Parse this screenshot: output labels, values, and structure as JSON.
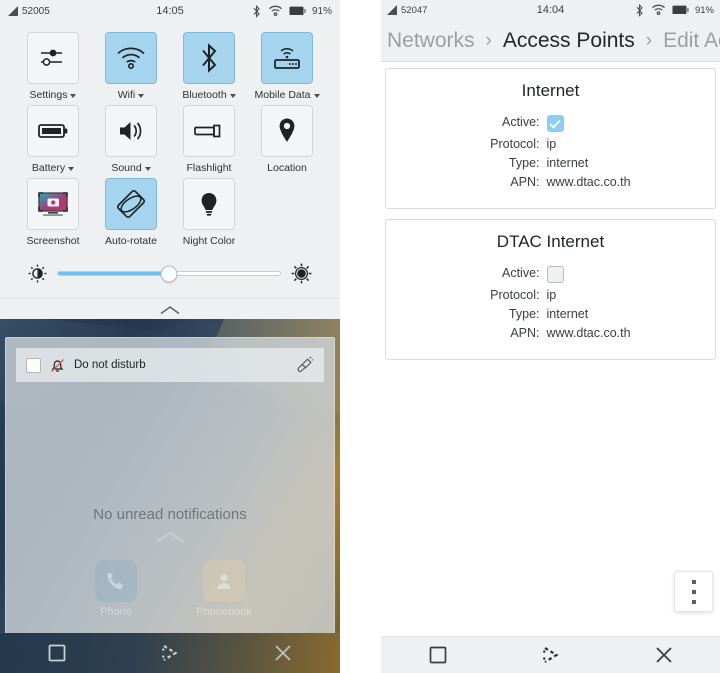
{
  "left_panel": {
    "statusbar": {
      "carrier": "52005",
      "clock": "14:05",
      "battery_percent": "91%",
      "icons": [
        "signal-icon",
        "bluetooth-icon",
        "wifi-icon",
        "battery-icon"
      ]
    },
    "quick_settings": {
      "tiles": [
        {
          "label": "Settings",
          "icon": "sliders-icon",
          "active": false,
          "has_menu": true
        },
        {
          "label": "Wifi",
          "icon": "wifi-icon",
          "active": true,
          "has_menu": true
        },
        {
          "label": "Bluetooth",
          "icon": "bluetooth-icon",
          "active": true,
          "has_menu": true
        },
        {
          "label": "Mobile Data",
          "icon": "router-icon",
          "active": true,
          "has_menu": true
        },
        {
          "label": "Battery",
          "icon": "battery-icon",
          "active": false,
          "has_menu": true
        },
        {
          "label": "Sound",
          "icon": "speaker-icon",
          "active": false,
          "has_menu": true
        },
        {
          "label": "Flashlight",
          "icon": "flashlight-icon",
          "active": false,
          "has_menu": false
        },
        {
          "label": "Location",
          "icon": "map-pin-icon",
          "active": false,
          "has_menu": false
        },
        {
          "label": "Screenshot",
          "icon": "screenshot-icon",
          "active": false,
          "has_menu": false
        },
        {
          "label": "Auto-rotate",
          "icon": "auto-rotate-icon",
          "active": true,
          "has_menu": false
        },
        {
          "label": "Night Color",
          "icon": "lightbulb-icon",
          "active": false,
          "has_menu": false
        }
      ]
    },
    "brightness": {
      "low_icon": "brightness-low-icon",
      "high_icon": "brightness-high-icon",
      "value_percent": 50
    },
    "collapse_icon": "chevron-up-icon",
    "notifications": {
      "do_not_disturb": {
        "label": "Do not disturb",
        "checked": false,
        "bell_icon": "bell-slash-icon",
        "clear_icon": "broom-icon"
      },
      "empty_text": "No unread notifications",
      "background_apps": [
        {
          "name": "Phone",
          "icon": "phone-icon"
        },
        {
          "name": "Phonebook",
          "icon": "contact-icon"
        }
      ]
    },
    "nav_bar": {
      "buttons": [
        {
          "name": "square-icon",
          "label": "Back"
        },
        {
          "name": "kde-logo-icon",
          "label": "Home"
        },
        {
          "name": "close-icon",
          "label": "Close"
        }
      ]
    }
  },
  "right_panel": {
    "statusbar": {
      "carrier": "52047",
      "clock": "14:04",
      "battery_percent": "91%"
    },
    "breadcrumb": [
      {
        "label": "Networks",
        "current": false
      },
      {
        "label": "Access Points",
        "current": true
      },
      {
        "label": "Edit Acc",
        "current": false
      }
    ],
    "breadcrumb_separator": "›",
    "cards": [
      {
        "title": "Internet",
        "active_label": "Active:",
        "active": true,
        "fields": [
          {
            "key": "Protocol:",
            "value": "ip"
          },
          {
            "key": "Type:",
            "value": "internet"
          },
          {
            "key": "APN:",
            "value": "www.dtac.co.th"
          }
        ]
      },
      {
        "title": "DTAC Internet",
        "active_label": "Active:",
        "active": false,
        "fields": [
          {
            "key": "Protocol:",
            "value": "ip"
          },
          {
            "key": "Type:",
            "value": "internet"
          },
          {
            "key": "APN:",
            "value": "www.dtac.co.th"
          }
        ]
      }
    ],
    "overflow_button": {
      "icon": "overflow-menu-icon"
    },
    "nav_bar": {
      "buttons": [
        {
          "name": "square-icon",
          "label": "Back"
        },
        {
          "name": "kde-logo-icon",
          "label": "Home"
        },
        {
          "name": "close-icon",
          "label": "Close"
        }
      ]
    }
  },
  "colors": {
    "tile_active": "#a5d4ef",
    "panel_bg": "#eff0f1",
    "slider_fill": "#6fc0ef",
    "checkbox_on": "#8ecdf2"
  }
}
